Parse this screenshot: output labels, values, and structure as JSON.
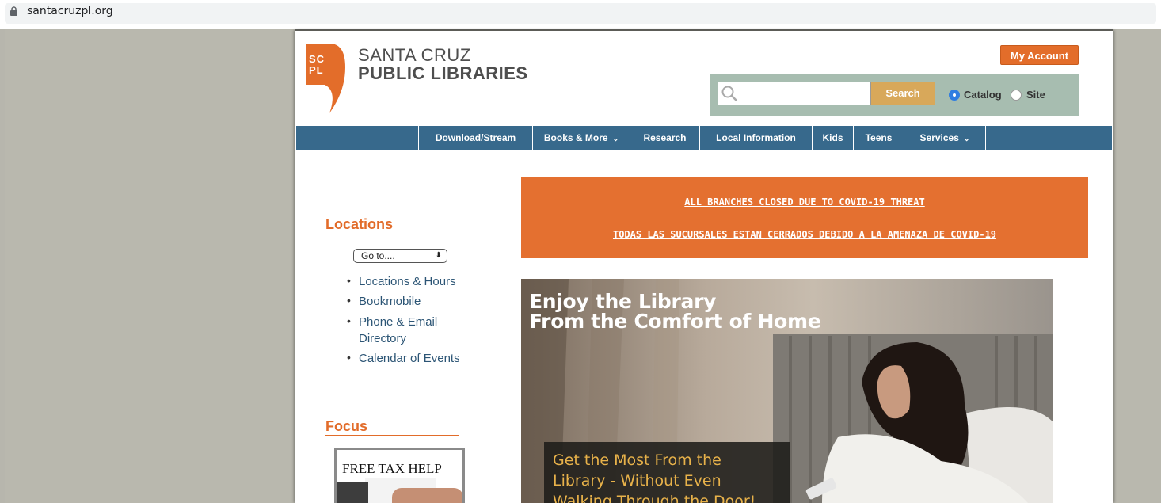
{
  "browser": {
    "url": "santacruzpl.org"
  },
  "header": {
    "logo_mark": "SC PL",
    "logo_line1": "SANTA CRUZ",
    "logo_line2": "PUBLIC LIBRARIES",
    "my_account": "My Account"
  },
  "search": {
    "placeholder": "",
    "button": "Search",
    "options": [
      {
        "label": "Catalog",
        "selected": true
      },
      {
        "label": "Site",
        "selected": false
      }
    ]
  },
  "nav": {
    "items": [
      {
        "label": "Download/Stream",
        "has_dropdown": false
      },
      {
        "label": "Books & More",
        "has_dropdown": true
      },
      {
        "label": "Research",
        "has_dropdown": false
      },
      {
        "label": "Local Information",
        "has_dropdown": false
      },
      {
        "label": "Kids",
        "has_dropdown": false
      },
      {
        "label": "Teens",
        "has_dropdown": false
      },
      {
        "label": "Services",
        "has_dropdown": true
      }
    ],
    "chevron": "⌄"
  },
  "sidebar": {
    "locations_title": "Locations",
    "goto_select": "Go to....",
    "links": [
      {
        "label": "Locations & Hours"
      },
      {
        "label": "Bookmobile"
      },
      {
        "label": "Phone & Email"
      },
      {
        "label": "Directory"
      },
      {
        "label": "Calendar of Events"
      }
    ],
    "focus_title": "Focus",
    "focus_image_caption": "FREE TAX HELP"
  },
  "alert": {
    "line1": "ALL BRANCHES CLOSED DUE TO COVID-19 THREAT",
    "line2": "TODAS LAS SUCURSALES ESTAN CERRADOS DEBIDO A LA AMENAZA DE COVID-19"
  },
  "hero": {
    "title_line1": "Enjoy the Library",
    "title_line2": "From the Comfort of Home",
    "box_line1": "Get the Most From the",
    "box_line2": "Library - Without Even",
    "box_line3": "Walking Through the Door!"
  },
  "colors": {
    "brand_orange": "#e36d2a",
    "nav_blue": "#37698c",
    "search_panel": "#a7bdb0",
    "search_button": "#d8a85a",
    "link_blue": "#2c5575",
    "outer_bg": "#b9b8ae"
  }
}
